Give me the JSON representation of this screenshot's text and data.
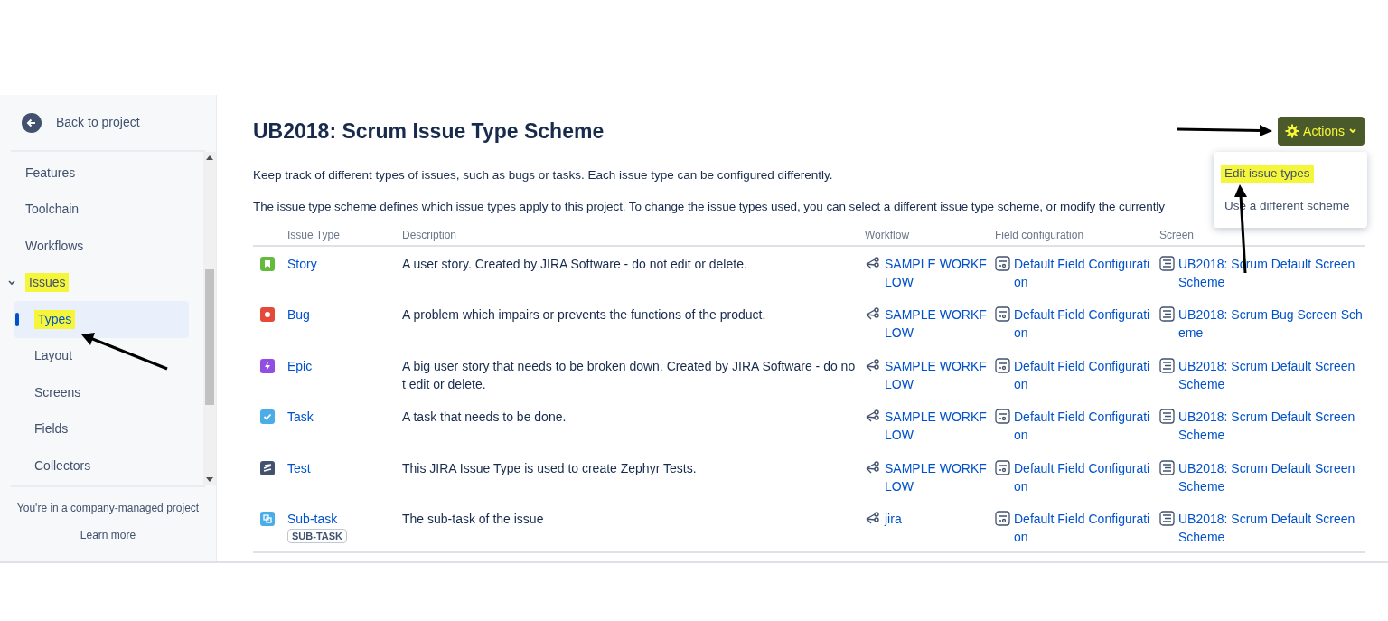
{
  "sidebar": {
    "back_link": "Back to project",
    "items": [
      {
        "label": "Features",
        "selected": false,
        "highlighted": false
      },
      {
        "label": "Toolchain",
        "selected": false,
        "highlighted": false
      },
      {
        "label": "Workflows",
        "selected": false,
        "highlighted": false
      },
      {
        "label": "Issues",
        "selected": false,
        "highlighted": true,
        "expanded": true,
        "children": [
          {
            "label": "Types",
            "selected": true,
            "highlighted": true
          },
          {
            "label": "Layout",
            "selected": false,
            "highlighted": false
          },
          {
            "label": "Screens",
            "selected": false,
            "highlighted": false
          },
          {
            "label": "Fields",
            "selected": false,
            "highlighted": false
          },
          {
            "label": "Collectors",
            "selected": false,
            "highlighted": false
          }
        ]
      }
    ],
    "footer": "You're in a company-managed project",
    "footer_link": "Learn more"
  },
  "page": {
    "title": "UB2018: Scrum Issue Type Scheme",
    "actions_button": {
      "label": "Actions",
      "highlighted": true
    },
    "actions_menu": [
      {
        "label": "Edit issue types",
        "highlighted": true
      },
      {
        "label": "Use a different scheme",
        "highlighted": false
      }
    ],
    "intro": [
      "Keep track of different types of issues, such as bugs or tasks. Each issue type can be configured differently.",
      "The issue type scheme defines which issue types apply to this project. To change the issue types used, you can select a different issue type scheme, or modify the currently"
    ]
  },
  "table": {
    "columns": [
      "Issue Type",
      "Description",
      "Workflow",
      "Field configuration",
      "Screen"
    ],
    "rows": [
      {
        "kind": "story",
        "color": "#63ba3c",
        "type": "Story",
        "description": "A user story. Created by JIRA Software - do not edit or delete.",
        "workflow": "SAMPLE WORKFLOW",
        "field_configuration": "Default Field Configuration",
        "screen": "UB2018: Scrum Default Screen Scheme"
      },
      {
        "kind": "bug",
        "color": "#e5493a",
        "type": "Bug",
        "description": "A problem which impairs or prevents the functions of the product.",
        "workflow": "SAMPLE WORKFLOW",
        "field_configuration": "Default Field Configuration",
        "screen": "UB2018: Scrum Bug Screen Scheme"
      },
      {
        "kind": "epic",
        "color": "#904ee2",
        "type": "Epic",
        "description": "A big user story that needs to be broken down. Created by JIRA Software - do not edit or delete.",
        "workflow": "SAMPLE WORKFLOW",
        "field_configuration": "Default Field Configuration",
        "screen": "UB2018: Scrum Default Screen Scheme"
      },
      {
        "kind": "task",
        "color": "#4bade8",
        "type": "Task",
        "description": "A task that needs to be done.",
        "workflow": "SAMPLE WORKFLOW",
        "field_configuration": "Default Field Configuration",
        "screen": "UB2018: Scrum Default Screen Scheme"
      },
      {
        "kind": "test",
        "color": "#42526e",
        "type": "Test",
        "description": "This JIRA Issue Type is used to create Zephyr Tests.",
        "workflow": "SAMPLE WORKFLOW",
        "field_configuration": "Default Field Configuration",
        "screen": "UB2018: Scrum Default Screen Scheme"
      },
      {
        "kind": "subtask",
        "color": "#4bade8",
        "type": "Sub-task",
        "badge": "SUB-TASK",
        "description": "The sub-task of the issue",
        "workflow": "jira",
        "field_configuration": "Default Field Configuration",
        "screen": "UB2018: Scrum Default Screen Scheme"
      }
    ]
  }
}
